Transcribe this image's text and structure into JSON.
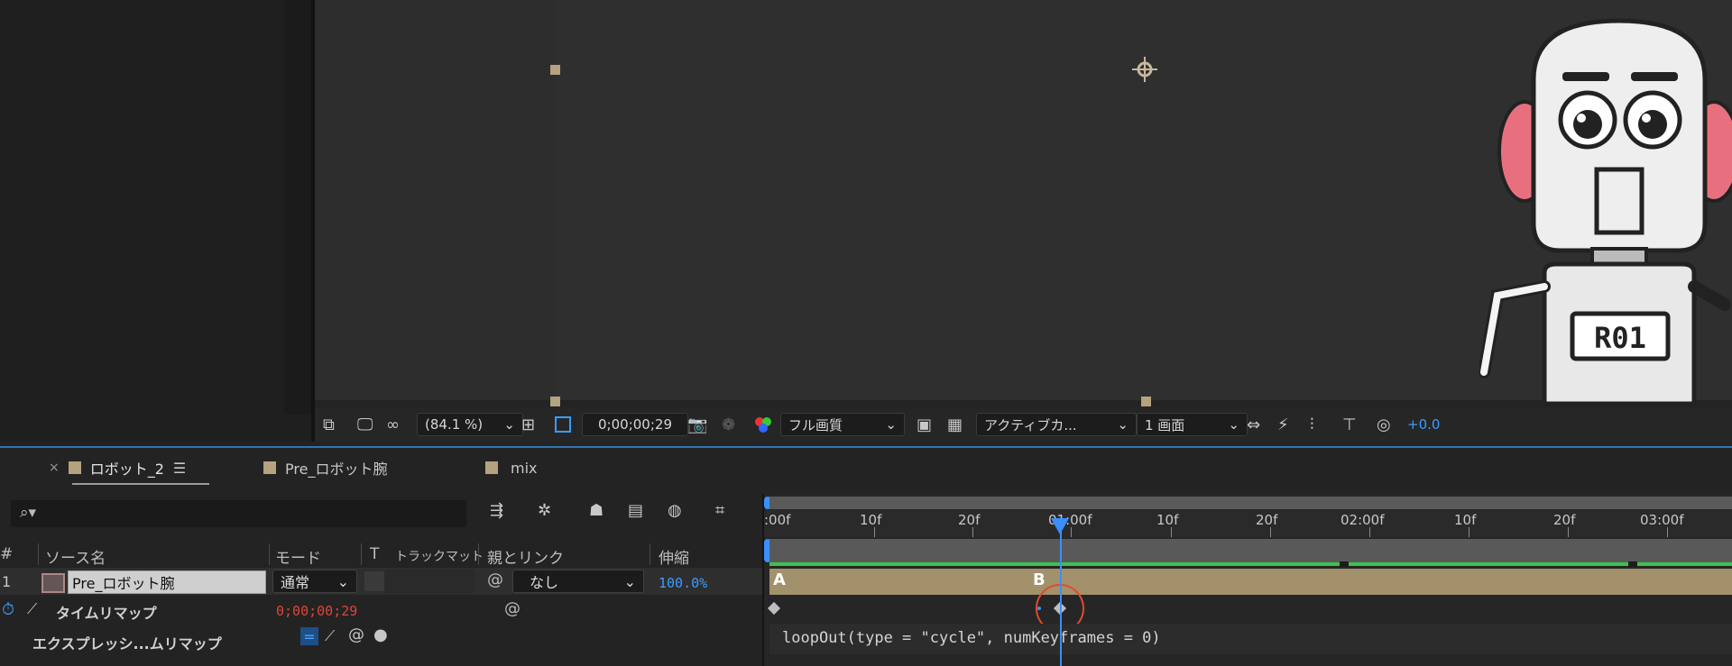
{
  "viewer_toolbar": {
    "zoom": "(84.1 %)",
    "timecode": "0;00;00;29",
    "quality": "フル画質",
    "camera": "アクティブカ...",
    "views": "1 画面",
    "exposure": "+0.0"
  },
  "tabs": [
    {
      "label": "ロボット_2",
      "menu_icon": "hamburger-menu-icon"
    },
    {
      "label": "Pre_ロボット腕"
    },
    {
      "label": "mix"
    }
  ],
  "tab_close": "×",
  "columns": {
    "hash": "#",
    "source_name": "ソース名",
    "mode": "モード",
    "t": "T",
    "track_matte": "トラックマット",
    "parent": "親とリンク",
    "stretch": "伸縮"
  },
  "layer": {
    "index": "1",
    "name": "Pre_ロボット腕",
    "mode": "通常",
    "parent": "なし",
    "stretch": "100.0%"
  },
  "property": {
    "name": "タイムリマップ",
    "value": "0;00;00;29"
  },
  "expression": {
    "label": "エクスプレッシ...ムリマップ",
    "code": "loopOut(type = \"cycle\", numKeyframes = 0)"
  },
  "ruler_labels": [
    ":00f",
    "10f",
    "20f",
    "01:00f",
    "10f",
    "20f",
    "02:00f",
    "10f",
    "20f",
    "03:00f"
  ],
  "markers": {
    "a": "A",
    "b": "B"
  },
  "robot": {
    "badge": "R01"
  },
  "colors": {
    "accent": "#3b9cff",
    "label_tan": "#b5a27e",
    "green": "#3cc24e",
    "red_circle": "#e04b2f"
  }
}
